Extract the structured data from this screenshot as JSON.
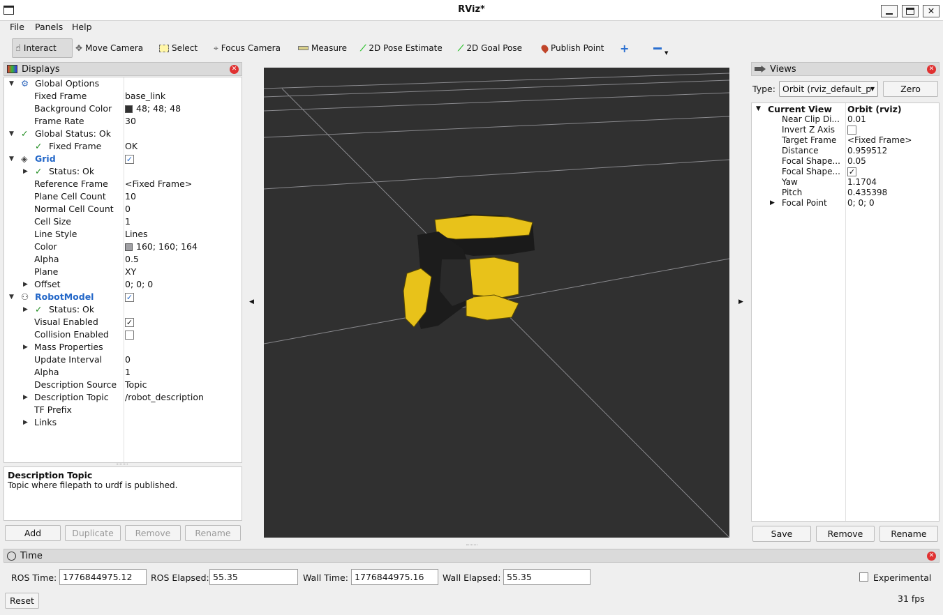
{
  "window": {
    "title": "RViz*"
  },
  "menu": [
    "File",
    "Panels",
    "Help"
  ],
  "toolbar": {
    "tools": [
      "Interact",
      "Move Camera",
      "Select",
      "Focus Camera",
      "Measure",
      "2D Pose Estimate",
      "2D Goal Pose",
      "Publish Point"
    ],
    "active": "Interact"
  },
  "displays": {
    "title": "Displays",
    "rows": [
      {
        "label": "Global Options",
        "value": "",
        "bold": false,
        "blue": false
      },
      {
        "label": "Fixed Frame",
        "value": "base_link"
      },
      {
        "label": "Background Color",
        "value": "48; 48; 48",
        "color": "#303030"
      },
      {
        "label": "Frame Rate",
        "value": "30"
      },
      {
        "label": "Global Status: Ok",
        "value": ""
      },
      {
        "label": "Fixed Frame",
        "value": "OK"
      },
      {
        "label": "Grid",
        "value": ""
      },
      {
        "label": "Status: Ok",
        "value": ""
      },
      {
        "label": "Reference Frame",
        "value": "<Fixed Frame>"
      },
      {
        "label": "Plane Cell Count",
        "value": "10"
      },
      {
        "label": "Normal Cell Count",
        "value": "0"
      },
      {
        "label": "Cell Size",
        "value": "1"
      },
      {
        "label": "Line Style",
        "value": "Lines"
      },
      {
        "label": "Color",
        "value": "160; 160; 164",
        "color": "#a0a0a4"
      },
      {
        "label": "Alpha",
        "value": "0.5"
      },
      {
        "label": "Plane",
        "value": "XY"
      },
      {
        "label": "Offset",
        "value": "0; 0; 0"
      },
      {
        "label": "RobotModel",
        "value": ""
      },
      {
        "label": "Status: Ok",
        "value": ""
      },
      {
        "label": "Visual Enabled",
        "value": ""
      },
      {
        "label": "Collision Enabled",
        "value": ""
      },
      {
        "label": "Mass Properties",
        "value": ""
      },
      {
        "label": "Update Interval",
        "value": "0"
      },
      {
        "label": "Alpha",
        "value": "1"
      },
      {
        "label": "Description Source",
        "value": "Topic"
      },
      {
        "label": "Description Topic",
        "value": "/robot_description"
      },
      {
        "label": "TF Prefix",
        "value": ""
      },
      {
        "label": "Links",
        "value": ""
      }
    ],
    "description_title": "Description Topic",
    "description_text": "Topic where filepath to urdf is published.",
    "buttons": [
      "Add",
      "Duplicate",
      "Remove",
      "Rename"
    ]
  },
  "views": {
    "title": "Views",
    "type_label": "Type:",
    "type_value": "Orbit (rviz_default_p",
    "zero_label": "Zero",
    "current_view": "Current View",
    "current_view_value": "Orbit (rviz)",
    "rows": [
      {
        "label": "Near Clip Di...",
        "value": "0.01"
      },
      {
        "label": "Invert Z Axis",
        "value": ""
      },
      {
        "label": "Target Frame",
        "value": "<Fixed Frame>"
      },
      {
        "label": "Distance",
        "value": "0.959512"
      },
      {
        "label": "Focal Shape...",
        "value": "0.05"
      },
      {
        "label": "Focal Shape...",
        "value": ""
      },
      {
        "label": "Yaw",
        "value": "1.1704"
      },
      {
        "label": "Pitch",
        "value": "0.435398"
      },
      {
        "label": "Focal Point",
        "value": "0; 0; 0"
      }
    ],
    "buttons": [
      "Save",
      "Remove",
      "Rename"
    ]
  },
  "time": {
    "title": "Time",
    "ros_time_label": "ROS Time:",
    "ros_time": "1776844975.12",
    "ros_elapsed_label": "ROS Elapsed:",
    "ros_elapsed": "55.35",
    "wall_time_label": "Wall Time:",
    "wall_time": "1776844975.16",
    "wall_elapsed_label": "Wall Elapsed:",
    "wall_elapsed": "55.35",
    "experimental_label": "Experimental",
    "reset_label": "Reset",
    "fps": "31 fps"
  },
  "viewport": {
    "background": "#303030",
    "grid_color": "#a0a0a4",
    "robot_color": "#e8c21a"
  }
}
